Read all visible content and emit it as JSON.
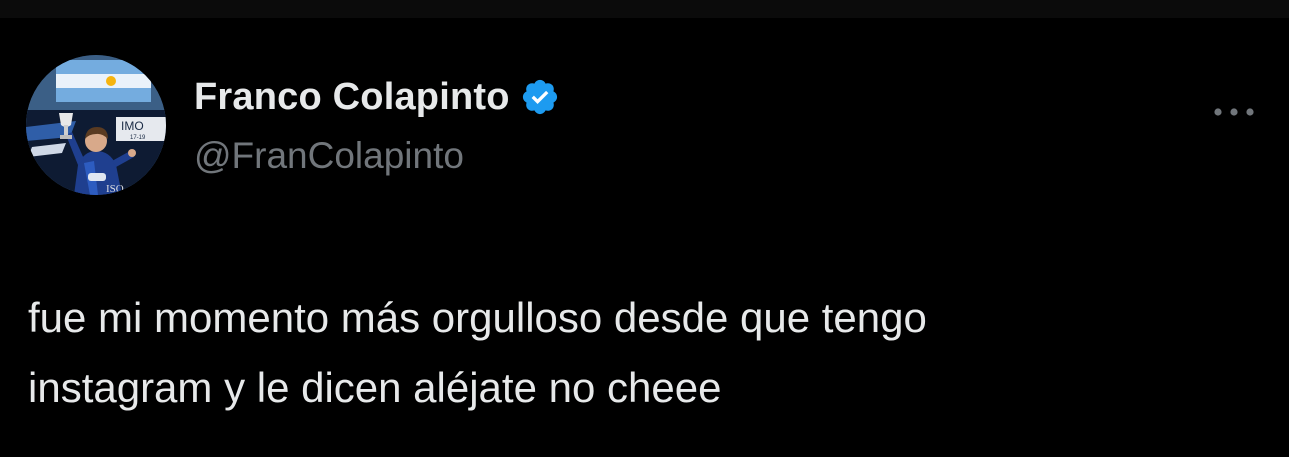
{
  "author": {
    "display_name": "Franco Colapinto",
    "handle": "@FranColapinto",
    "verified": true,
    "verified_color": "#1d9bf0"
  },
  "avatar": {
    "description_icon": "profile-photo",
    "banner_text": "IMO",
    "banner_subtext": "17-19"
  },
  "tweet": {
    "text": "fue mi momento más orgulloso desde que tengo\ninstagram y le dicen aléjate no cheee"
  },
  "menu": {
    "icon": "more-horizontal-icon"
  },
  "colors": {
    "background": "#000000",
    "primary_text": "#e7e9ea",
    "secondary_text": "#71767b"
  }
}
